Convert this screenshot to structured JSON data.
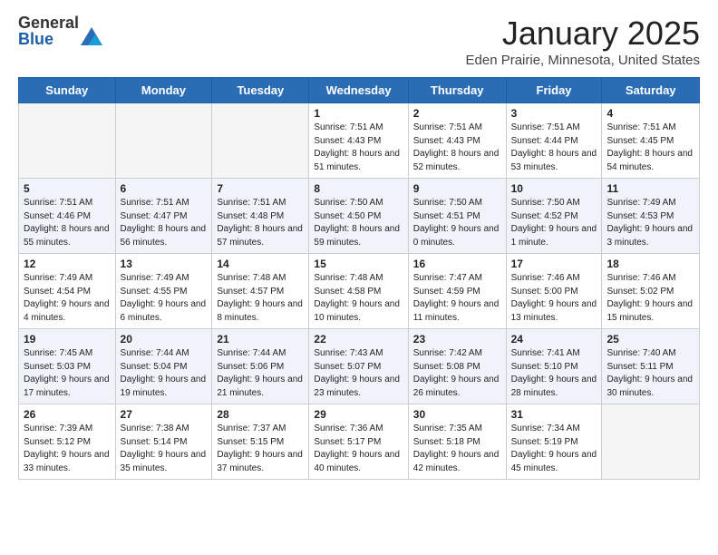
{
  "header": {
    "logo_general": "General",
    "logo_blue": "Blue",
    "month_title": "January 2025",
    "location": "Eden Prairie, Minnesota, United States"
  },
  "days_of_week": [
    "Sunday",
    "Monday",
    "Tuesday",
    "Wednesday",
    "Thursday",
    "Friday",
    "Saturday"
  ],
  "weeks": [
    [
      {
        "day": "",
        "info": ""
      },
      {
        "day": "",
        "info": ""
      },
      {
        "day": "",
        "info": ""
      },
      {
        "day": "1",
        "info": "Sunrise: 7:51 AM\nSunset: 4:43 PM\nDaylight: 8 hours and 51 minutes."
      },
      {
        "day": "2",
        "info": "Sunrise: 7:51 AM\nSunset: 4:43 PM\nDaylight: 8 hours and 52 minutes."
      },
      {
        "day": "3",
        "info": "Sunrise: 7:51 AM\nSunset: 4:44 PM\nDaylight: 8 hours and 53 minutes."
      },
      {
        "day": "4",
        "info": "Sunrise: 7:51 AM\nSunset: 4:45 PM\nDaylight: 8 hours and 54 minutes."
      }
    ],
    [
      {
        "day": "5",
        "info": "Sunrise: 7:51 AM\nSunset: 4:46 PM\nDaylight: 8 hours and 55 minutes."
      },
      {
        "day": "6",
        "info": "Sunrise: 7:51 AM\nSunset: 4:47 PM\nDaylight: 8 hours and 56 minutes."
      },
      {
        "day": "7",
        "info": "Sunrise: 7:51 AM\nSunset: 4:48 PM\nDaylight: 8 hours and 57 minutes."
      },
      {
        "day": "8",
        "info": "Sunrise: 7:50 AM\nSunset: 4:50 PM\nDaylight: 8 hours and 59 minutes."
      },
      {
        "day": "9",
        "info": "Sunrise: 7:50 AM\nSunset: 4:51 PM\nDaylight: 9 hours and 0 minutes."
      },
      {
        "day": "10",
        "info": "Sunrise: 7:50 AM\nSunset: 4:52 PM\nDaylight: 9 hours and 1 minute."
      },
      {
        "day": "11",
        "info": "Sunrise: 7:49 AM\nSunset: 4:53 PM\nDaylight: 9 hours and 3 minutes."
      }
    ],
    [
      {
        "day": "12",
        "info": "Sunrise: 7:49 AM\nSunset: 4:54 PM\nDaylight: 9 hours and 4 minutes."
      },
      {
        "day": "13",
        "info": "Sunrise: 7:49 AM\nSunset: 4:55 PM\nDaylight: 9 hours and 6 minutes."
      },
      {
        "day": "14",
        "info": "Sunrise: 7:48 AM\nSunset: 4:57 PM\nDaylight: 9 hours and 8 minutes."
      },
      {
        "day": "15",
        "info": "Sunrise: 7:48 AM\nSunset: 4:58 PM\nDaylight: 9 hours and 10 minutes."
      },
      {
        "day": "16",
        "info": "Sunrise: 7:47 AM\nSunset: 4:59 PM\nDaylight: 9 hours and 11 minutes."
      },
      {
        "day": "17",
        "info": "Sunrise: 7:46 AM\nSunset: 5:00 PM\nDaylight: 9 hours and 13 minutes."
      },
      {
        "day": "18",
        "info": "Sunrise: 7:46 AM\nSunset: 5:02 PM\nDaylight: 9 hours and 15 minutes."
      }
    ],
    [
      {
        "day": "19",
        "info": "Sunrise: 7:45 AM\nSunset: 5:03 PM\nDaylight: 9 hours and 17 minutes."
      },
      {
        "day": "20",
        "info": "Sunrise: 7:44 AM\nSunset: 5:04 PM\nDaylight: 9 hours and 19 minutes."
      },
      {
        "day": "21",
        "info": "Sunrise: 7:44 AM\nSunset: 5:06 PM\nDaylight: 9 hours and 21 minutes."
      },
      {
        "day": "22",
        "info": "Sunrise: 7:43 AM\nSunset: 5:07 PM\nDaylight: 9 hours and 23 minutes."
      },
      {
        "day": "23",
        "info": "Sunrise: 7:42 AM\nSunset: 5:08 PM\nDaylight: 9 hours and 26 minutes."
      },
      {
        "day": "24",
        "info": "Sunrise: 7:41 AM\nSunset: 5:10 PM\nDaylight: 9 hours and 28 minutes."
      },
      {
        "day": "25",
        "info": "Sunrise: 7:40 AM\nSunset: 5:11 PM\nDaylight: 9 hours and 30 minutes."
      }
    ],
    [
      {
        "day": "26",
        "info": "Sunrise: 7:39 AM\nSunset: 5:12 PM\nDaylight: 9 hours and 33 minutes."
      },
      {
        "day": "27",
        "info": "Sunrise: 7:38 AM\nSunset: 5:14 PM\nDaylight: 9 hours and 35 minutes."
      },
      {
        "day": "28",
        "info": "Sunrise: 7:37 AM\nSunset: 5:15 PM\nDaylight: 9 hours and 37 minutes."
      },
      {
        "day": "29",
        "info": "Sunrise: 7:36 AM\nSunset: 5:17 PM\nDaylight: 9 hours and 40 minutes."
      },
      {
        "day": "30",
        "info": "Sunrise: 7:35 AM\nSunset: 5:18 PM\nDaylight: 9 hours and 42 minutes."
      },
      {
        "day": "31",
        "info": "Sunrise: 7:34 AM\nSunset: 5:19 PM\nDaylight: 9 hours and 45 minutes."
      },
      {
        "day": "",
        "info": ""
      }
    ]
  ]
}
